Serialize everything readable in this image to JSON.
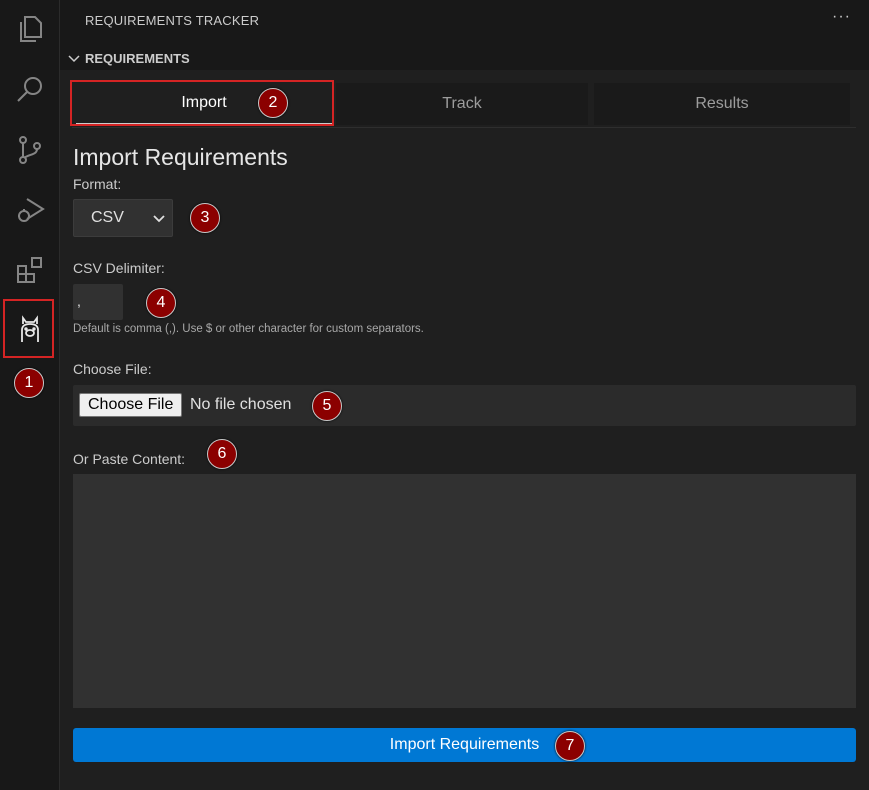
{
  "sidebar": {
    "title": "REQUIREMENTS TRACKER",
    "more_label": "···",
    "section_label": "REQUIREMENTS"
  },
  "activity_bar": {
    "items": [
      {
        "icon": "files-icon"
      },
      {
        "icon": "search-icon"
      },
      {
        "icon": "source-control-icon"
      },
      {
        "icon": "run-debug-icon"
      },
      {
        "icon": "extensions-icon"
      },
      {
        "icon": "llama-icon",
        "active": true
      }
    ]
  },
  "tabs": [
    {
      "label": "Import",
      "active": true
    },
    {
      "label": "Track",
      "active": false
    },
    {
      "label": "Results",
      "active": false
    }
  ],
  "form": {
    "heading": "Import Requirements",
    "format_label": "Format:",
    "format_value": "CSV",
    "delimiter_label": "CSV Delimiter:",
    "delimiter_value": ",",
    "delimiter_hint": "Default is comma (,). Use $ or other character for custom separators.",
    "file_label": "Choose File:",
    "choose_file_button": "Choose File",
    "no_file_text": "No file chosen",
    "paste_label": "Or Paste Content:",
    "paste_value": "",
    "submit_label": "Import Requirements"
  },
  "markers": [
    "1",
    "2",
    "3",
    "4",
    "5",
    "6",
    "7"
  ],
  "colors": {
    "accent": "#0078d4",
    "marker": "#8b0000",
    "highlight": "#d42424",
    "background": "#181818"
  }
}
